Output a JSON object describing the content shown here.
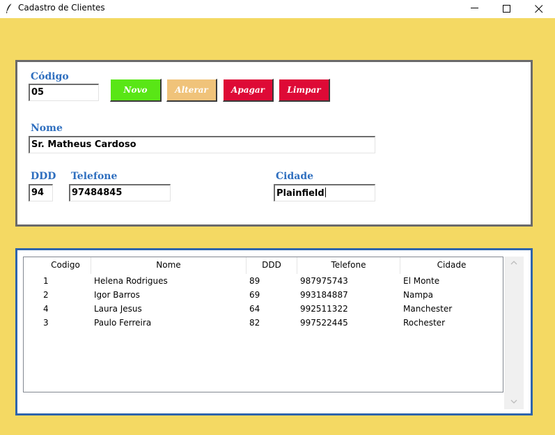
{
  "window": {
    "title": "Cadastro de Clientes",
    "icons": {
      "app": "feather-icon",
      "minimize": "minimize-icon",
      "maximize": "maximize-icon",
      "close": "close-icon"
    }
  },
  "form": {
    "codigo": {
      "label": "Código",
      "value": "05"
    },
    "nome": {
      "label": "Nome",
      "value": "Sr. Matheus Cardoso"
    },
    "ddd": {
      "label": "DDD",
      "value": "94"
    },
    "telefone": {
      "label": "Telefone",
      "value": "97484845"
    },
    "cidade": {
      "label": "Cidade",
      "value": "Plainfield"
    },
    "buttons": {
      "novo": "Novo",
      "alterar": "Alterar",
      "apagar": "Apagar",
      "limpar": "Limpar"
    }
  },
  "table": {
    "columns": [
      "Codigo",
      "Nome",
      "DDD",
      "Telefone",
      "Cidade"
    ],
    "rows": [
      [
        "1",
        "Helena Rodrigues",
        "89",
        "987975743",
        "El Monte"
      ],
      [
        "2",
        "Igor Barros",
        "69",
        "993184887",
        "Nampa"
      ],
      [
        "4",
        "Laura Jesus",
        "64",
        "992511322",
        "Manchester"
      ],
      [
        "3",
        "Paulo Ferreira",
        "82",
        "997522445",
        "Rochester"
      ]
    ]
  },
  "colors": {
    "background": "#f4d963",
    "label": "#2f6fbf",
    "novo": "#59e616",
    "alterar": "#f0c37a",
    "apagar": "#de0a36",
    "limpar": "#de0a36",
    "list_border": "#2e64ac"
  }
}
